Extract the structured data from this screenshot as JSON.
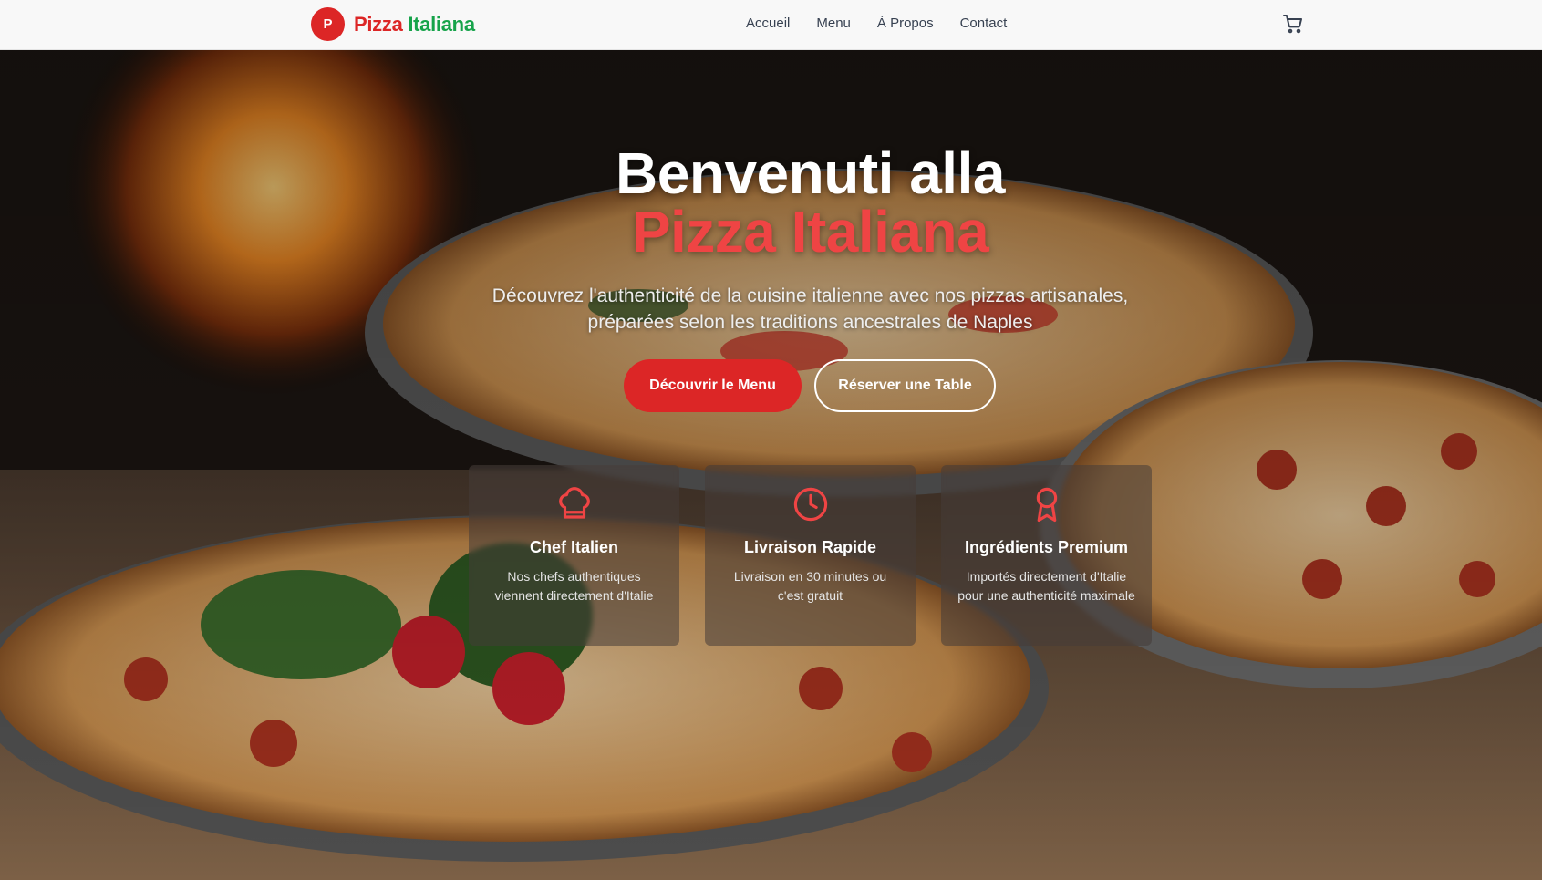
{
  "nav": {
    "logo_letter": "P",
    "brand_word1": "Pizza",
    "brand_word2": "Italiana",
    "links": [
      "Accueil",
      "Menu",
      "À Propos",
      "Contact"
    ],
    "cart_icon": "shopping-cart-icon"
  },
  "hero": {
    "title_line1": "Benvenuti alla",
    "title_line2": "Pizza Italiana",
    "subtitle_line1": "Découvrez l'authenticité de la cuisine italienne avec nos pizzas artisanales,",
    "subtitle_line2": "préparées selon les traditions ancestrales de Naples",
    "primary_button": "Découvrir le Menu",
    "secondary_button": "Réserver une Table"
  },
  "features": [
    {
      "icon": "chef-hat-icon",
      "title": "Chef Italien",
      "desc": "Nos chefs authentiques viennent directement d'Italie"
    },
    {
      "icon": "clock-icon",
      "title": "Livraison Rapide",
      "desc": "Livraison en 30 minutes ou c'est gratuit"
    },
    {
      "icon": "award-ribbon-icon",
      "title": "Ingrédients Premium",
      "desc": "Importés directement d'Italie pour une authenticité maximale"
    }
  ],
  "colors": {
    "accent_red": "#dc2626",
    "brand_green": "#16a34a",
    "navbar_bg": "#f8f8f8"
  }
}
